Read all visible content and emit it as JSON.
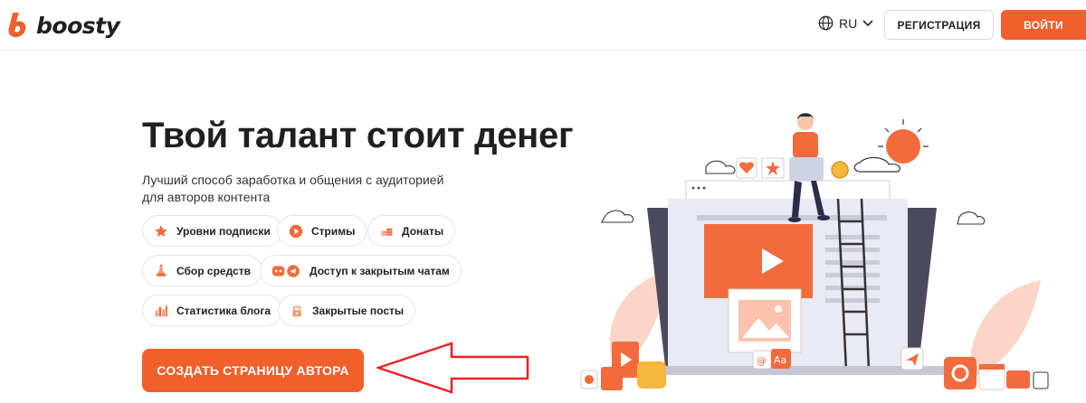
{
  "header": {
    "logo_text": "boosty",
    "language": "RU",
    "register_label": "РЕГИСТРАЦИЯ",
    "login_label": "ВОЙТИ"
  },
  "hero": {
    "title": "Твой талант стоит денег",
    "subtitle_line1": "Лучший способ заработка и общения с аудиторией",
    "subtitle_line2": "для авторов контента"
  },
  "features": [
    {
      "label": "Уровни подписки",
      "icon": "star-icon"
    },
    {
      "label": "Стримы",
      "icon": "play-icon"
    },
    {
      "label": "Донаты",
      "icon": "coins-icon"
    },
    {
      "label": "Сбор средств",
      "icon": "flask-icon"
    },
    {
      "label": "Доступ к закрытым чатам",
      "icon": "discord-telegram-icon"
    },
    {
      "label": "Статистика блога",
      "icon": "bar-chart-icon"
    },
    {
      "label": "Закрытые посты",
      "icon": "lock-icon"
    }
  ],
  "cta": {
    "label": "СОЗДАТЬ СТРАНИЦУ АВТОРА"
  },
  "colors": {
    "accent": "#f15f2c",
    "annotation_arrow": "#e8222a"
  }
}
